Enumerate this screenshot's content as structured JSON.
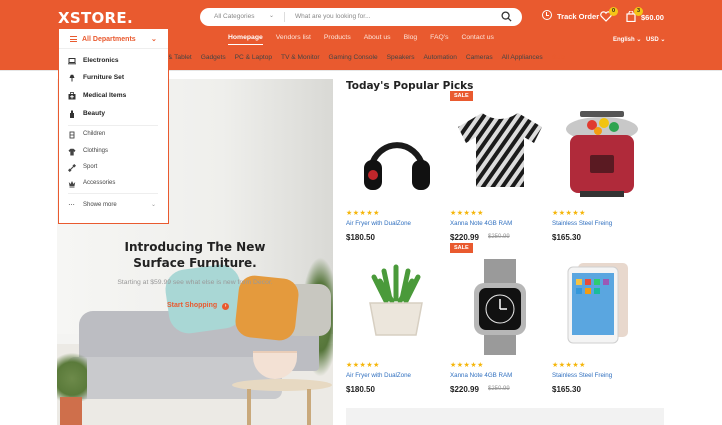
{
  "header": {
    "logo": "XSTORE.",
    "search": {
      "category": "All Categories",
      "placeholder": "What are you looking for..."
    },
    "track_order": "Track Order",
    "wishlist_count": "0",
    "cart_count": "3",
    "cart_total": "$60.00",
    "nav": [
      "Homepage",
      "Vendors list",
      "Products",
      "About us",
      "Blog",
      "FAQ's",
      "Contact us"
    ],
    "language": "English",
    "currency": "USD",
    "accent_color": "#e95a2f"
  },
  "category_bar": [
    "& Tablet",
    "Gadgets",
    "PC & Laptop",
    "TV & Monitor",
    "Gaming Console",
    "Speakers",
    "Automation",
    "Cameras",
    "All Appliances",
    "Sale"
  ],
  "departments": {
    "title": "All Departments",
    "main_items": [
      {
        "label": "Electronics",
        "icon": "laptop-icon"
      },
      {
        "label": "Furniture Set",
        "icon": "lamp-icon"
      },
      {
        "label": "Medical Items",
        "icon": "medical-bag-icon"
      },
      {
        "label": "Beauty",
        "icon": "bottle-icon"
      }
    ],
    "sub_items": [
      {
        "label": "Children",
        "icon": "toy-icon"
      },
      {
        "label": "Clothings",
        "icon": "shirt-icon"
      },
      {
        "label": "Sport",
        "icon": "dumbbell-icon"
      },
      {
        "label": "Accessories",
        "icon": "crown-icon"
      }
    ],
    "show_more": "Showe more"
  },
  "hero": {
    "title_line1": "Introducing The New",
    "title_line2": "Surface Furniture.",
    "subtitle": "Starting at $59.99 see what else is new from Decor.",
    "cta": "Start Shopping"
  },
  "popular": {
    "title": "Today's Popular Picks",
    "products": [
      {
        "name": "Air Fryer with DualZone",
        "price": "$180.50",
        "old_price": "",
        "sale": "",
        "stars": "★★★★★",
        "image": "headphones"
      },
      {
        "name": "Xanna Note 4GB RAM",
        "price": "$220.99",
        "old_price": "$250.99",
        "sale": "SALE",
        "stars": "★★★★★",
        "image": "tshirt"
      },
      {
        "name": "Stainless Steel Freing",
        "price": "$165.30",
        "old_price": "",
        "sale": "",
        "stars": "★★★★★",
        "image": "rice-cooker"
      },
      {
        "name": "Air Fryer with DualZone",
        "price": "$180.50",
        "old_price": "",
        "sale": "",
        "stars": "★★★★★",
        "image": "plant-pot"
      },
      {
        "name": "Xanna Note 4GB RAM",
        "price": "$220.99",
        "old_price": "$250.99",
        "sale": "SALE",
        "stars": "★★★★★",
        "image": "smartwatch"
      },
      {
        "name": "Stainless Steel Freing",
        "price": "$165.30",
        "old_price": "",
        "sale": "",
        "stars": "★★★★★",
        "image": "tablet"
      }
    ]
  }
}
